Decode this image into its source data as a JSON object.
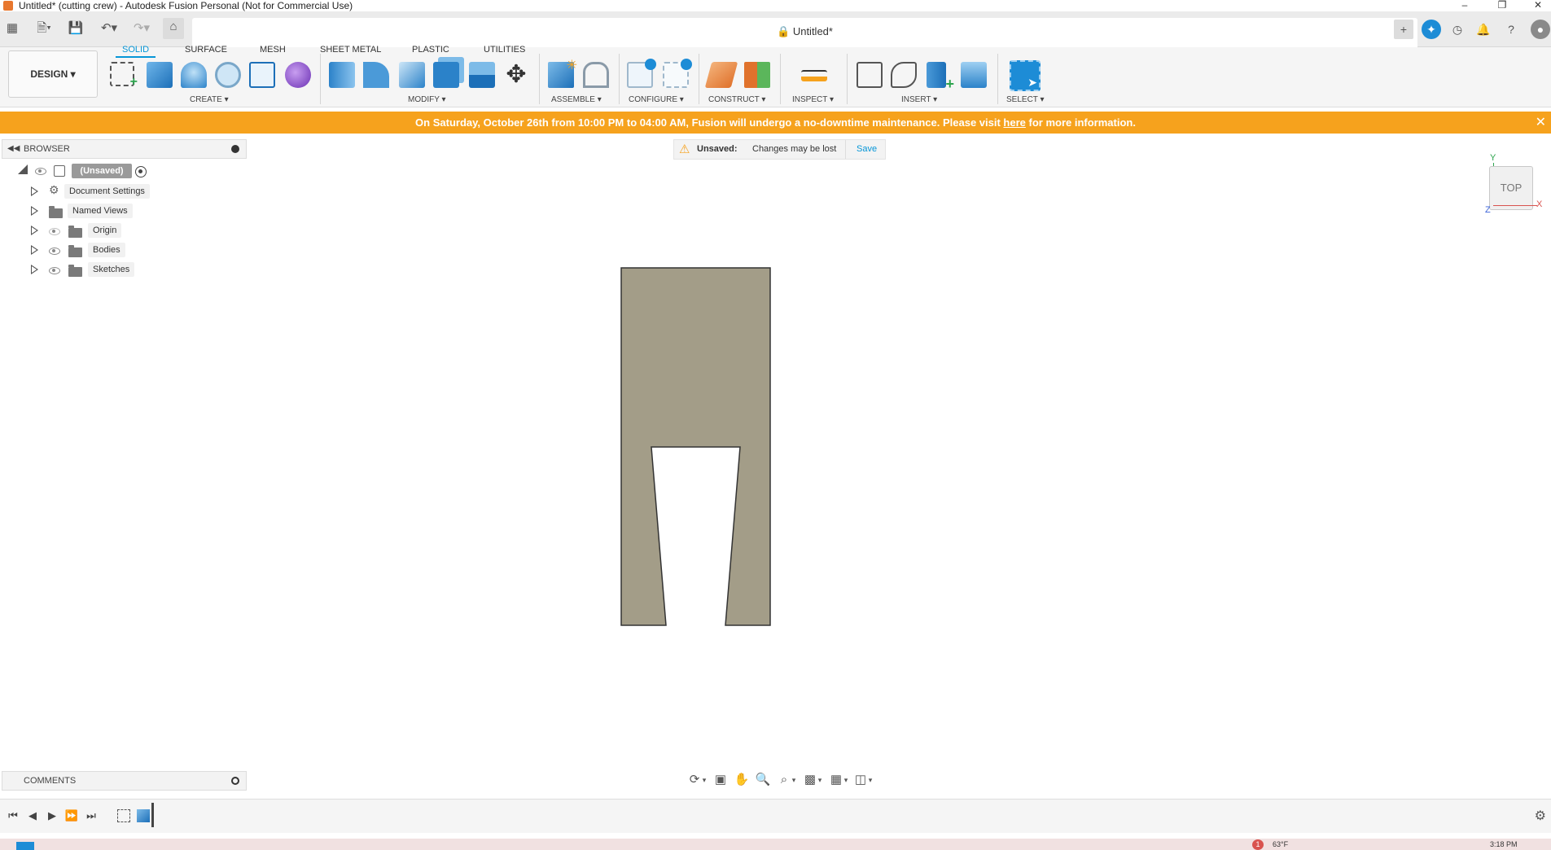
{
  "window": {
    "title": "Untitled* (cutting crew) - Autodesk Fusion Personal (Not for Commercial Use)",
    "minimize_icon": "minimize-icon",
    "restore_icon": "restore-icon",
    "close_icon": "close-icon"
  },
  "document_tab": {
    "title": "Untitled*",
    "lock_icon": "lock-icon",
    "close_icon": "close-icon"
  },
  "workspace": {
    "label": "DESIGN"
  },
  "ribbon_tabs": [
    {
      "label": "SOLID",
      "active": true
    },
    {
      "label": "SURFACE",
      "active": false
    },
    {
      "label": "MESH",
      "active": false
    },
    {
      "label": "SHEET METAL",
      "active": false
    },
    {
      "label": "PLASTIC",
      "active": false
    },
    {
      "label": "UTILITIES",
      "active": false
    }
  ],
  "ribbon_groups": [
    {
      "label": "CREATE"
    },
    {
      "label": "MODIFY"
    },
    {
      "label": "ASSEMBLE"
    },
    {
      "label": "CONFIGURE"
    },
    {
      "label": "CONSTRUCT"
    },
    {
      "label": "INSPECT"
    },
    {
      "label": "INSERT"
    },
    {
      "label": "SELECT"
    }
  ],
  "banner": {
    "text_before": "On Saturday, October 26th from 10:00 PM to 04:00 AM, Fusion will undergo a no-downtime maintenance. Please visit ",
    "link": "here",
    "text_after": " for more information."
  },
  "browser": {
    "title": "BROWSER",
    "root": "(Unsaved)",
    "items": [
      {
        "label": "Document Settings"
      },
      {
        "label": "Named Views"
      },
      {
        "label": "Origin"
      },
      {
        "label": "Bodies"
      },
      {
        "label": "Sketches"
      }
    ]
  },
  "unsaved_bar": {
    "label": "Unsaved:",
    "message": "Changes may be lost",
    "save": "Save"
  },
  "viewcube": {
    "face": "TOP",
    "axis_y": "Y",
    "axis_x": "X",
    "axis_z": "Z"
  },
  "comments": {
    "title": "COMMENTS"
  },
  "colors": {
    "accent": "#0696d7",
    "banner": "#f6a21d",
    "body_fill": "#a39d88",
    "body_stroke": "#333333"
  },
  "taskbar": {
    "badge": "1",
    "weather": "63°F",
    "time": "3:18 PM"
  }
}
